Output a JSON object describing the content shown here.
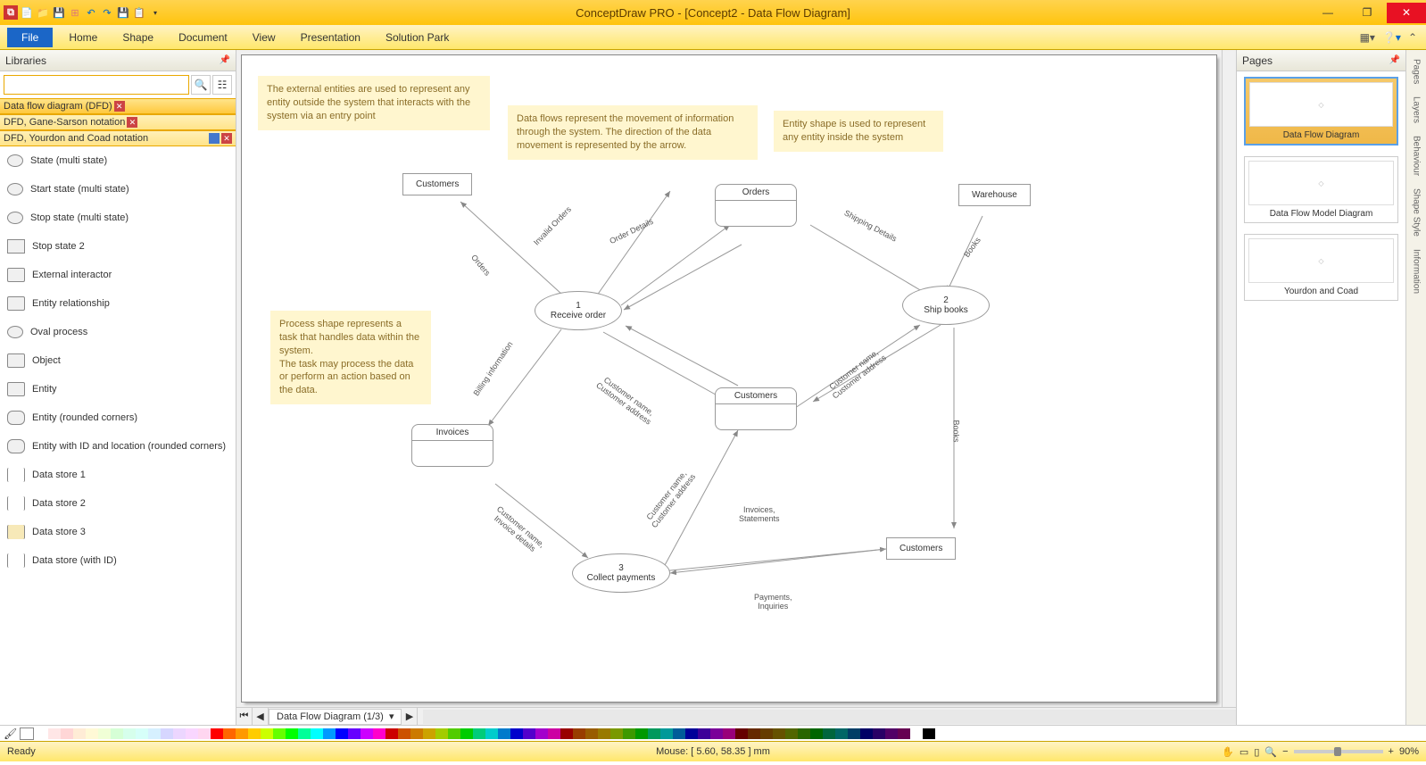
{
  "app": {
    "title": "ConceptDraw PRO - [Concept2 - Data Flow Diagram]"
  },
  "menus": {
    "file": "File",
    "home": "Home",
    "shape": "Shape",
    "document": "Document",
    "view": "View",
    "presentation": "Presentation",
    "solution_park": "Solution Park"
  },
  "panels": {
    "libraries": "Libraries",
    "pages": "Pages"
  },
  "lib_groups": {
    "g1": "Data flow diagram (DFD)",
    "g2": "DFD, Gane-Sarson notation",
    "g3": "DFD, Yourdon and Coad notation"
  },
  "lib_items": {
    "i1": "State (multi state)",
    "i2": "Start state (multi state)",
    "i3": "Stop state (multi state)",
    "i4": "Stop state 2",
    "i5": "External interactor",
    "i6": "Entity relationship",
    "i7": "Oval process",
    "i8": "Object",
    "i9": "Entity",
    "i10": "Entity (rounded corners)",
    "i11": "Entity with ID and location (rounded corners)",
    "i12": "Data store 1",
    "i13": "Data store 2",
    "i14": "Data store 3",
    "i15": "Data store (with ID)"
  },
  "notes": {
    "n1": "The external entities are used to represent any entity outside the system that interacts with the system via an entry point",
    "n2": "Data flows represent the movement of information through the system. The direction of the data movement is represented by the arrow.",
    "n3": "Entity shape is used to represent any entity inside the system",
    "n4": "Process shape represents a task that handles data within the system.\nThe task may process the data or perform an action based on the data."
  },
  "shapes": {
    "customers_top": "Customers",
    "orders": "Orders",
    "warehouse": "Warehouse",
    "p1_num": "1",
    "p1": "Receive order",
    "p2_num": "2",
    "p2": "Ship books",
    "p3_num": "3",
    "p3": "Collect payments",
    "invoices": "Invoices",
    "customers_mid": "Customers",
    "customers_right": "Customers"
  },
  "flows": {
    "invalid_orders": "Invalid Orders",
    "order_details": "Order Details",
    "shipping_details": "Shipping Details",
    "books1": "Books",
    "orders_f": "Orders",
    "billing": "Billing information",
    "cust_addr1": "Customer name,\nCustomer address",
    "cust_addr2": "Customer name,\nCustomer address",
    "cust_addr3": "Customer name,\nCustomer address",
    "books2": "Books",
    "inv_stmt": "Invoices,\nStatements",
    "cust_inv": "Customer name,\nInvoice details",
    "pay_inq": "Payments,\nInquiries"
  },
  "page_thumbs": {
    "p1": "Data Flow Diagram",
    "p2": "Data Flow Model Diagram",
    "p3": "Yourdon and Coad"
  },
  "side_tabs": {
    "t1": "Pages",
    "t2": "Layers",
    "t3": "Behaviour",
    "t4": "Shape Style",
    "t5": "Information"
  },
  "page_tab": {
    "name": "Data Flow Diagram (1/3)"
  },
  "status": {
    "ready": "Ready",
    "mouse": "Mouse: [ 5.60, 58.35 ] mm",
    "zoom": "90%"
  }
}
